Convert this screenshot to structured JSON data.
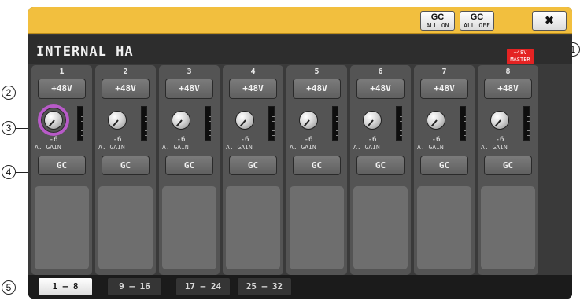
{
  "toolbar": {
    "gc_all_on": {
      "top": "GC",
      "bottom": "ALL ON"
    },
    "gc_all_off": {
      "top": "GC",
      "bottom": "ALL OFF"
    },
    "close_label": "✖"
  },
  "title": "INTERNAL HA",
  "master_badge": {
    "line1": "+48V",
    "line2": "MASTER"
  },
  "channels": [
    {
      "number": "1",
      "phantom_label": "+48V",
      "gain_value": "-6",
      "gain_label": "A. GAIN",
      "gc_label": "GC"
    },
    {
      "number": "2",
      "phantom_label": "+48V",
      "gain_value": "-6",
      "gain_label": "A. GAIN",
      "gc_label": "GC"
    },
    {
      "number": "3",
      "phantom_label": "+48V",
      "gain_value": "-6",
      "gain_label": "A. GAIN",
      "gc_label": "GC"
    },
    {
      "number": "4",
      "phantom_label": "+48V",
      "gain_value": "-6",
      "gain_label": "A. GAIN",
      "gc_label": "GC"
    },
    {
      "number": "5",
      "phantom_label": "+48V",
      "gain_value": "-6",
      "gain_label": "A. GAIN",
      "gc_label": "GC"
    },
    {
      "number": "6",
      "phantom_label": "+48V",
      "gain_value": "-6",
      "gain_label": "A. GAIN",
      "gc_label": "GC"
    },
    {
      "number": "7",
      "phantom_label": "+48V",
      "gain_value": "-6",
      "gain_label": "A. GAIN",
      "gc_label": "GC"
    },
    {
      "number": "8",
      "phantom_label": "+48V",
      "gain_value": "-6",
      "gain_label": "A. GAIN",
      "gc_label": "GC"
    }
  ],
  "tabs": [
    {
      "label": "1 – 8",
      "active": true
    },
    {
      "label": "9 – 16",
      "active": false
    },
    {
      "label": "17 – 24",
      "active": false
    },
    {
      "label": "25 – 32",
      "active": false
    }
  ],
  "callouts": [
    "1",
    "2",
    "3",
    "4",
    "5"
  ],
  "colors": {
    "header": "#f2bf3e",
    "master_badge": "#e42323",
    "knob_ring_selected": "#b85ac8"
  }
}
